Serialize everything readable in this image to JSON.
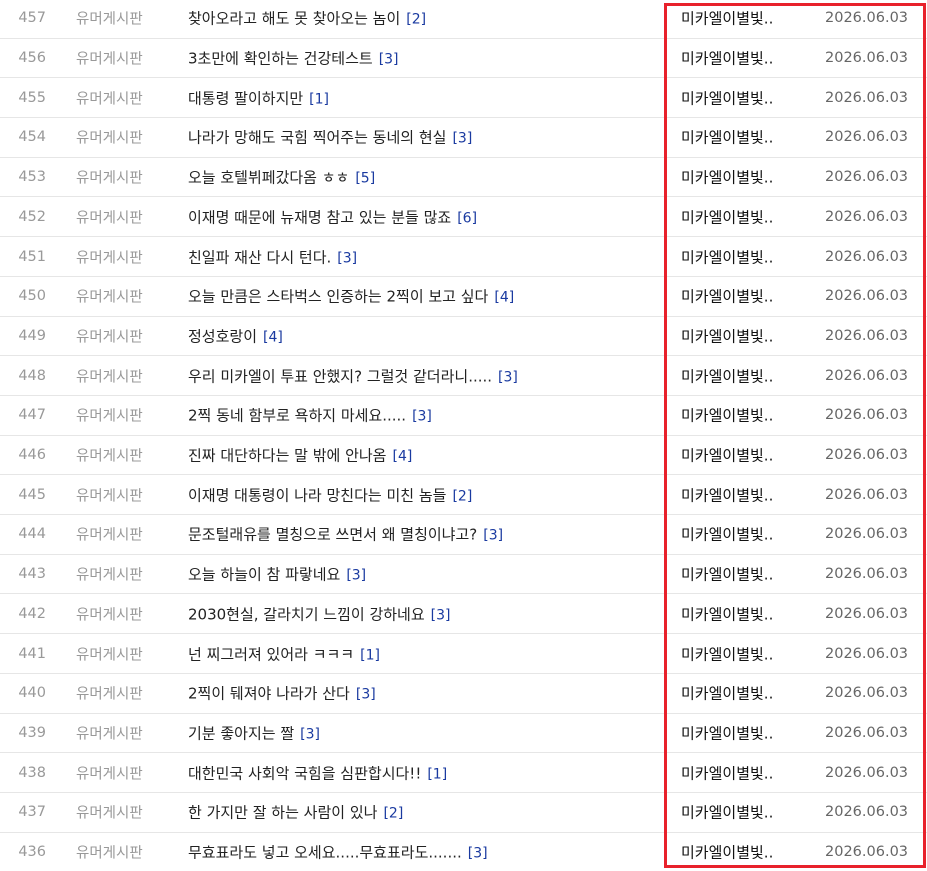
{
  "accent_color": "#e8212b",
  "comment_color": "#1a3aa0",
  "posts": [
    {
      "num": "457",
      "category": "유머게시판",
      "title": "찾아오라고 해도 못 찾아오는 놈이",
      "comments": "[2]",
      "author": "미카엘이별빛..",
      "date": "2026.06.03"
    },
    {
      "num": "456",
      "category": "유머게시판",
      "title": "3초만에 확인하는 건강테스트",
      "comments": "[3]",
      "author": "미카엘이별빛..",
      "date": "2026.06.03"
    },
    {
      "num": "455",
      "category": "유머게시판",
      "title": "대통령 팔이하지만",
      "comments": "[1]",
      "author": "미카엘이별빛..",
      "date": "2026.06.03"
    },
    {
      "num": "454",
      "category": "유머게시판",
      "title": "나라가 망해도 국힘 찍어주는 동네의 현실",
      "comments": "[3]",
      "author": "미카엘이별빛..",
      "date": "2026.06.03"
    },
    {
      "num": "453",
      "category": "유머게시판",
      "title": "오늘 호텔뷔페갔다옴 ㅎㅎ",
      "comments": "[5]",
      "author": "미카엘이별빛..",
      "date": "2026.06.03"
    },
    {
      "num": "452",
      "category": "유머게시판",
      "title": "이재명 때문에 뉴재명 참고 있는 분들 많죠",
      "comments": "[6]",
      "author": "미카엘이별빛..",
      "date": "2026.06.03"
    },
    {
      "num": "451",
      "category": "유머게시판",
      "title": "친일파 재산 다시 턴다.",
      "comments": "[3]",
      "author": "미카엘이별빛..",
      "date": "2026.06.03"
    },
    {
      "num": "450",
      "category": "유머게시판",
      "title": "오늘 만큼은 스타벅스 인증하는 2찍이 보고 싶다",
      "comments": "[4]",
      "author": "미카엘이별빛..",
      "date": "2026.06.03"
    },
    {
      "num": "449",
      "category": "유머게시판",
      "title": "정성호랑이",
      "comments": "[4]",
      "author": "미카엘이별빛..",
      "date": "2026.06.03"
    },
    {
      "num": "448",
      "category": "유머게시판",
      "title": "우리 미카엘이 투표 안했지? 그럴것 같더라니.....",
      "comments": "[3]",
      "author": "미카엘이별빛..",
      "date": "2026.06.03"
    },
    {
      "num": "447",
      "category": "유머게시판",
      "title": "2찍 동네 함부로 욕하지 마세요.....",
      "comments": "[3]",
      "author": "미카엘이별빛..",
      "date": "2026.06.03"
    },
    {
      "num": "446",
      "category": "유머게시판",
      "title": "진짜 대단하다는 말 밖에 안나옴",
      "comments": "[4]",
      "author": "미카엘이별빛..",
      "date": "2026.06.03"
    },
    {
      "num": "445",
      "category": "유머게시판",
      "title": "이재명 대통령이 나라 망친다는 미친 놈들",
      "comments": "[2]",
      "author": "미카엘이별빛..",
      "date": "2026.06.03"
    },
    {
      "num": "444",
      "category": "유머게시판",
      "title": "문조털래유를 멸칭으로 쓰면서 왜 멸칭이냐고?",
      "comments": "[3]",
      "author": "미카엘이별빛..",
      "date": "2026.06.03"
    },
    {
      "num": "443",
      "category": "유머게시판",
      "title": "오늘 하늘이 참 파랗네요",
      "comments": "[3]",
      "author": "미카엘이별빛..",
      "date": "2026.06.03"
    },
    {
      "num": "442",
      "category": "유머게시판",
      "title": "2030현실, 갈라치기 느낌이 강하네요",
      "comments": "[3]",
      "author": "미카엘이별빛..",
      "date": "2026.06.03"
    },
    {
      "num": "441",
      "category": "유머게시판",
      "title": "넌 찌그러져 있어라 ㅋㅋㅋ",
      "comments": "[1]",
      "author": "미카엘이별빛..",
      "date": "2026.06.03"
    },
    {
      "num": "440",
      "category": "유머게시판",
      "title": "2찍이 뒈져야 나라가 산다",
      "comments": "[3]",
      "author": "미카엘이별빛..",
      "date": "2026.06.03"
    },
    {
      "num": "439",
      "category": "유머게시판",
      "title": "기분 좋아지는 짤",
      "comments": "[3]",
      "author": "미카엘이별빛..",
      "date": "2026.06.03"
    },
    {
      "num": "438",
      "category": "유머게시판",
      "title": "대한민국 사회악 국힘을 심판합시다!!",
      "comments": "[1]",
      "author": "미카엘이별빛..",
      "date": "2026.06.03"
    },
    {
      "num": "437",
      "category": "유머게시판",
      "title": "한 가지만 잘 하는 사람이 있나",
      "comments": "[2]",
      "author": "미카엘이별빛..",
      "date": "2026.06.03"
    },
    {
      "num": "436",
      "category": "유머게시판",
      "title": "무효표라도 넣고 오세요.....무효표라도.......",
      "comments": "[3]",
      "author": "미카엘이별빛..",
      "date": "2026.06.03"
    }
  ]
}
